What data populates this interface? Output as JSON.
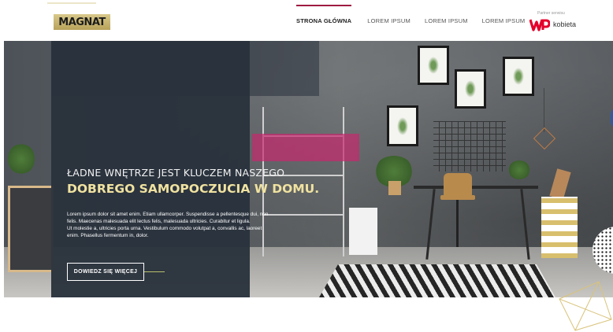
{
  "brand": {
    "logo_text": "MAGNAT",
    "accent_color": "#9e1b42",
    "headline_accent": "#f0e2a0"
  },
  "nav": {
    "items": [
      {
        "label": "STRONA GŁÓWNA",
        "active": true
      },
      {
        "label": "LOREM IPSUM",
        "active": false
      },
      {
        "label": "LOREM IPSUM",
        "active": false
      },
      {
        "label": "LOREM IPSUM",
        "active": false
      }
    ]
  },
  "partner": {
    "label": "Partner serwisu",
    "name": "kobieta",
    "logo": "wp-logo-icon"
  },
  "hero": {
    "headline_line1": "ŁADNE WNĘTRZE JEST KLUCZEM NASZEGO",
    "headline_line2": "DOBREGO SAMOPOCZUCIA W DOMU.",
    "body_lines": [
      "Lorem ipsum dolor sit amet enim. Etiam ullamcorper. Suspendisse a pellentesque dui, non",
      "felis. Maecenas malesuada elit lectus felis, malesuada ultricies. Curabitur et ligula.",
      "Ut molestie a, ultricies porta urna. Vestibulum commodo volutpat a, convallis ac, laoreet",
      "enim. Phasellus fermentum in, dolor."
    ],
    "cta_label": "DOWIEDZ SIĘ WIĘCEJ"
  }
}
